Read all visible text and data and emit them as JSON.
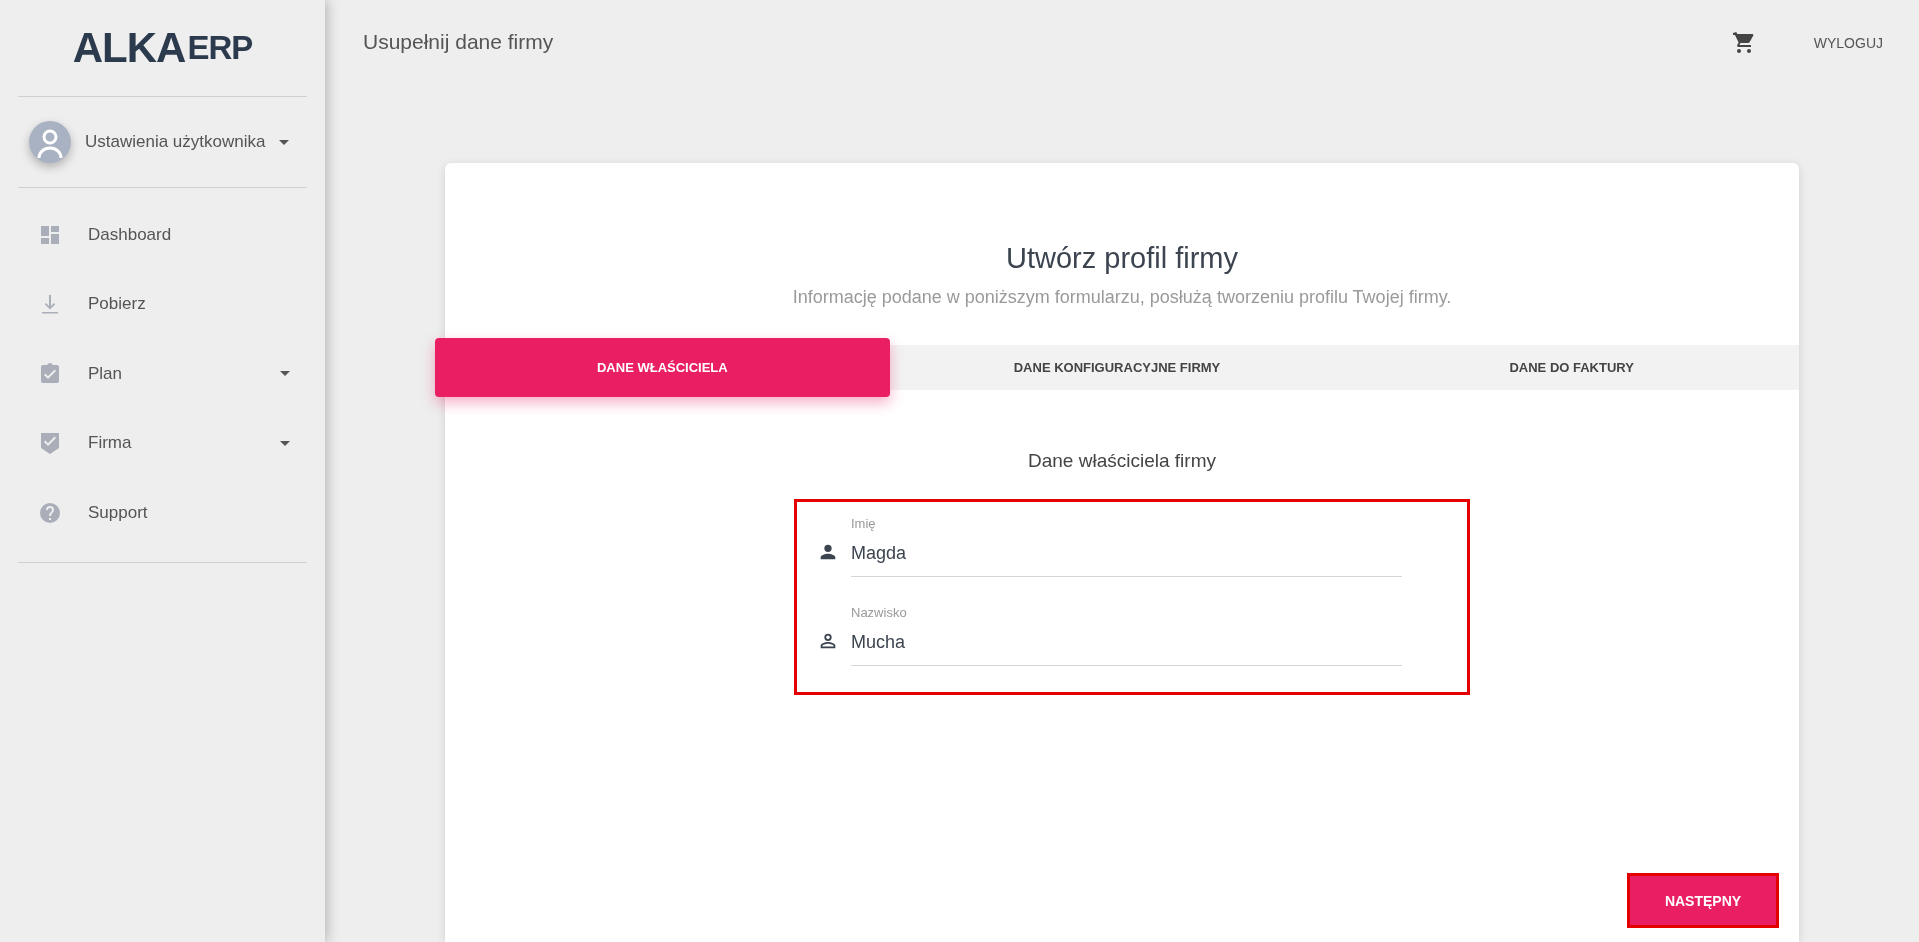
{
  "sidebar": {
    "logo": {
      "primary": "ALKA",
      "secondary": "ERP"
    },
    "user_menu": {
      "label": "Ustawienia użytkownika",
      "expandable": true
    },
    "items": [
      {
        "label": "Dashboard",
        "expandable": false
      },
      {
        "label": "Pobierz",
        "expandable": false
      },
      {
        "label": "Plan",
        "expandable": true
      },
      {
        "label": "Firma",
        "expandable": true
      },
      {
        "label": "Support",
        "expandable": false
      }
    ]
  },
  "header": {
    "title": "Usupełnij dane firmy",
    "logout": "WYLOGUJ"
  },
  "card": {
    "title": "Utwórz profil firmy",
    "subtitle": "Informację podane w poniższym formularzu, posłużą tworzeniu profilu Twojej firmy.",
    "tabs": [
      {
        "label": "DANE WŁAŚCICIELA",
        "selected": true
      },
      {
        "label": "DANE KONFIGURACYJNE FIRMY",
        "selected": false
      },
      {
        "label": "DANE DO FAKTURY",
        "selected": false
      }
    ],
    "section_title": "Dane właściciela firmy",
    "fields": [
      {
        "label": "Imię",
        "value": "Magda"
      },
      {
        "label": "Nazwisko",
        "value": "Mucha"
      }
    ],
    "next_button": "NASTĘPNY"
  }
}
